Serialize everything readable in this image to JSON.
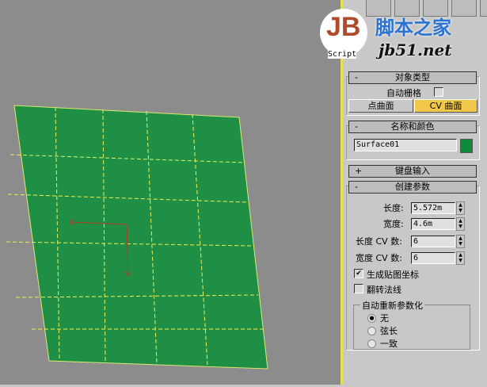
{
  "watermark": {
    "logo": "JB",
    "script": "Script",
    "site_cn": "脚本之家",
    "site_url": "jb51.net"
  },
  "colors": {
    "surface": "#1f8f45",
    "swatch": "#108a3a",
    "active_btn": "#f2c84b"
  },
  "object_type": {
    "title": "对象类型",
    "collapse": "-",
    "autogrid_label": "自动栅格",
    "autogrid_checked": false,
    "point_surface": "点曲面",
    "cv_surface": "CV 曲面"
  },
  "name_color": {
    "title": "名称和颜色",
    "collapse": "-",
    "name": "Surface01"
  },
  "keyboard": {
    "title": "键盘输入",
    "collapse": "+"
  },
  "params": {
    "title": "创建参数",
    "collapse": "-",
    "length_label": "长度:",
    "length": "5.572m",
    "width_label": "宽度:",
    "width": "4.6m",
    "length_cv_label": "长度 CV 数:",
    "length_cv": "6",
    "width_cv_label": "宽度 CV 数:",
    "width_cv": "6",
    "gen_mapping": "生成贴图坐标",
    "gen_mapping_checked": true,
    "flip_normals": "翻转法线",
    "flip_normals_checked": false,
    "reparam_title": "自动重新参数化",
    "options": [
      "无",
      "弦长",
      "一致"
    ],
    "selected": 0
  }
}
